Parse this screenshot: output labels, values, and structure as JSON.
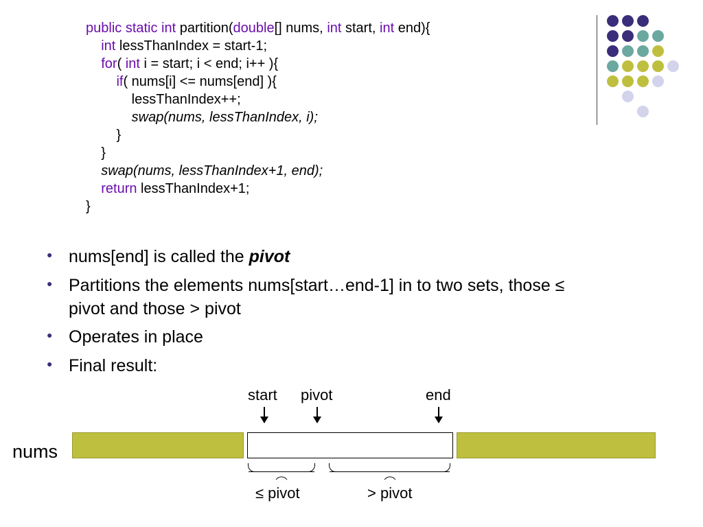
{
  "code": {
    "l1a": "public static int ",
    "l1b": "partition(",
    "l1c": "double",
    "l1d": "[] nums, ",
    "l1e": "int ",
    "l1f": "start, ",
    "l1g": "int ",
    "l1h": "end){",
    "l2a": "    int ",
    "l2b": "lessThanIndex = start-1;",
    "l3a": "    for",
    "l3b": "( ",
    "l3c": "int ",
    "l3d": "i = start; i < end; i++ ){",
    "l4a": "        if",
    "l4b": "( nums[i] <= nums[end] ){",
    "l5": "            lessThanIndex++;",
    "l6": "            swap(nums, lessThanIndex, i);",
    "l7": "        }",
    "l8": "    }",
    "l9": "    swap(nums, lessThanIndex+1, end);",
    "l10a": "    return ",
    "l10b": "lessThanIndex+1;",
    "l11": "}"
  },
  "bullets": {
    "b1a": "nums[end] is called the ",
    "b1b": "pivot",
    "b2": "Partitions the elements nums[start…end-1] in to two sets, those ≤ pivot and those > pivot",
    "b3": "Operates in place",
    "b4": "Final result:"
  },
  "diagram": {
    "nums": "nums",
    "start": "start",
    "pivot": "pivot",
    "end": "end",
    "le": "≤ pivot",
    "gt": "> pivot"
  }
}
